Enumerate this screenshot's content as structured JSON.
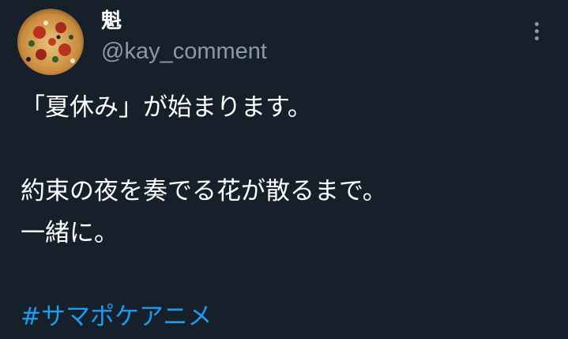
{
  "author": {
    "display_name": "魁",
    "handle": "@kay_comment"
  },
  "more_icon": "more-vertical-icon",
  "tweet": {
    "lines": [
      "「夏休み」が始まります。",
      "",
      "約束の夜を奏でる花が散るまで。",
      "一緒に。",
      ""
    ],
    "hashtag": "#サマポケアニメ"
  },
  "colors": {
    "background": "#15202b",
    "text": "#ffffff",
    "secondary_text": "#8b98a5",
    "link": "#1d9bf0"
  }
}
